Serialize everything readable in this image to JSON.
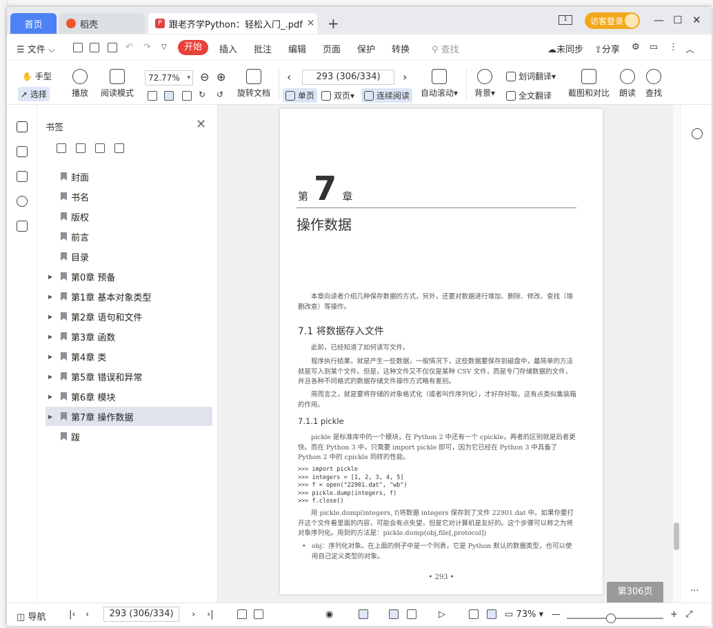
{
  "titlebar": {
    "tab_home": "首页",
    "tab_docer": "稻壳",
    "tab_doc": "跟老齐学Python：轻松入门_.pdf",
    "guest_login": "访客登录"
  },
  "menu": {
    "file": "文件",
    "start": "开始",
    "insert": "插入",
    "annotate": "批注",
    "edit": "编辑",
    "page": "页面",
    "protect": "保护",
    "convert": "转换",
    "search": "查找",
    "not_synced": "未同步",
    "share": "分享"
  },
  "ribbon": {
    "hand": "手型",
    "select": "选择",
    "play": "播放",
    "read_mode": "阅读模式",
    "zoom": "72.77%",
    "rotate": "旋转文档",
    "page_nav": "293 (306/334)",
    "single": "单页",
    "double": "双页",
    "continuous": "连续阅读",
    "auto_scroll": "自动滚动",
    "background": "背景",
    "word_translate": "划词翻译",
    "full_translate": "全文翻译",
    "screenshot_compare": "截图和对比",
    "read_aloud": "朗读",
    "find": "查找"
  },
  "bookmarks": {
    "title": "书签",
    "items": [
      {
        "label": "封面",
        "expandable": false
      },
      {
        "label": "书名",
        "expandable": false
      },
      {
        "label": "版权",
        "expandable": false
      },
      {
        "label": "前言",
        "expandable": false
      },
      {
        "label": "目录",
        "expandable": false
      },
      {
        "label": "第0章 预备",
        "expandable": true
      },
      {
        "label": "第1章 基本对象类型",
        "expandable": true
      },
      {
        "label": "第2章 语句和文件",
        "expandable": true
      },
      {
        "label": "第3章 函数",
        "expandable": true
      },
      {
        "label": "第4章 类",
        "expandable": true
      },
      {
        "label": "第5章 错误和异常",
        "expandable": true
      },
      {
        "label": "第6章 模块",
        "expandable": true
      },
      {
        "label": "第7章 操作数据",
        "expandable": true,
        "selected": true
      },
      {
        "label": "跋",
        "expandable": false
      }
    ]
  },
  "document": {
    "chapter_prefix": "第",
    "chapter_number": "7",
    "chapter_suffix": "章",
    "chapter_title": "操作数据",
    "intro": "本章向读者介绍几种保存数据的方式，另外，还要对数据进行增加、删除、修改、查找（增删改查）等操作。",
    "section_heading": "7.1   将数据存入文件",
    "p1": "此前，已经知道了如何读写文件。",
    "p2": "程序执行结果，就是产生一些数据，一般情况下，这些数据要保存到磁盘中，最简单的方法就是写入到某个文件。但是，这种文件又不仅仅是某种 CSV 文件，而是专门存储数据的文件，并且各种不同格式的数据存储文件操作方式略有差别。",
    "p3": "简而言之，就是要将存储的对象格式化（或者叫作序列化），才好存好取。这有点类似集装箱的作用。",
    "subsection_heading": "7.1.1   pickle",
    "p4": "pickle 是标准库中的一个模块，在 Python 2 中还有一个 cpickle，两者的区别就是后者更快。而在 Python 3 中，只需要 import pickle 即可，因为它已经在 Python 3 中具备了 Python 2 中的 cpickle 同样的性能。",
    "code": ">>> import pickle\n>>> integers = [1, 2, 3, 4, 5]\n>>> f = open(\"22901.dat\", \"wb\")\n>>> pickle.dump(integers, f)\n>>> f.close()",
    "p5": "用 pickle.dump(integers, f)将数据 integers 保存到了文件 22901.dat 中。如果你要打开这个文件看里面的内容，可能会有点失望，但是它对计算机是友好的。这个步骤可以称之为将对象序列化。用到的方法是：pickle.dump(obj,file[,protocol])",
    "bullet": "obj：序列化对象。在上面的例子中是一个列表，它是 Python 默认的数据类型，也可以使用自己定义类型的对象。",
    "page_number": "• 293 •"
  },
  "page_badge": "第306页",
  "statusbar": {
    "nav": "导航",
    "page": "293 (306/334)",
    "zoom": "73%"
  },
  "zoom_level": 0.73
}
